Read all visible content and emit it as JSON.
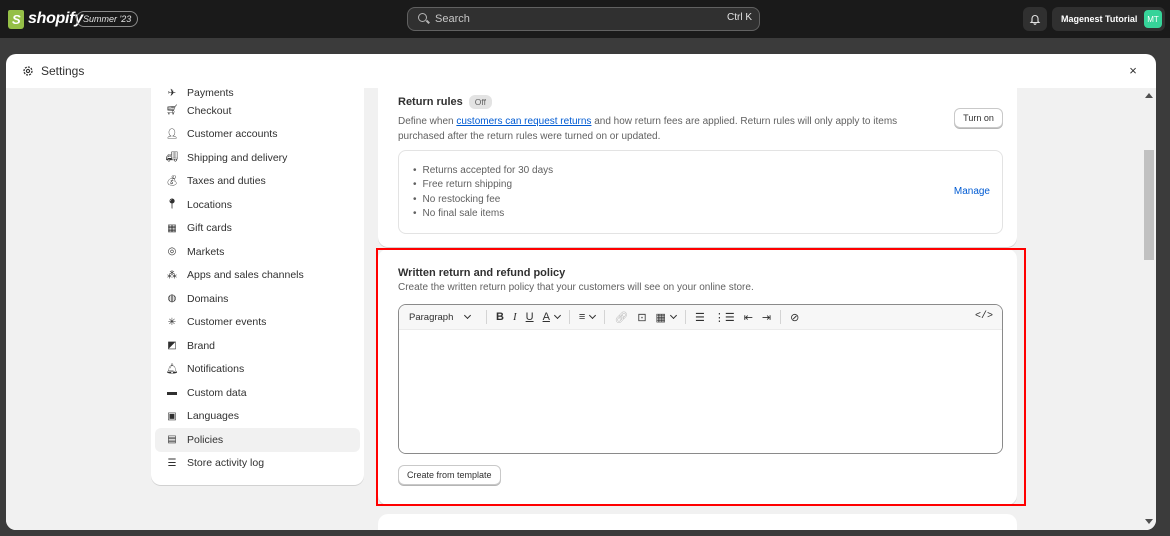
{
  "topbar": {
    "brand": "shopify",
    "edition_badge": "Summer '23",
    "search_placeholder": "Search",
    "search_shortcut": "Ctrl K",
    "user_name": "Magenest Tutorial",
    "user_initials": "MT"
  },
  "modal": {
    "title": "Settings",
    "close_label": "×"
  },
  "sidebar": {
    "items": [
      {
        "label": "Payments",
        "icon": "payments-icon"
      },
      {
        "label": "Checkout",
        "icon": "cart-icon"
      },
      {
        "label": "Customer accounts",
        "icon": "person-icon"
      },
      {
        "label": "Shipping and delivery",
        "icon": "truck-icon"
      },
      {
        "label": "Taxes and duties",
        "icon": "tax-icon"
      },
      {
        "label": "Locations",
        "icon": "location-pin-icon"
      },
      {
        "label": "Gift cards",
        "icon": "gift-card-icon"
      },
      {
        "label": "Markets",
        "icon": "globe-icon"
      },
      {
        "label": "Apps and sales channels",
        "icon": "apps-icon"
      },
      {
        "label": "Domains",
        "icon": "globe-icon"
      },
      {
        "label": "Customer events",
        "icon": "sparkle-icon"
      },
      {
        "label": "Brand",
        "icon": "brand-icon"
      },
      {
        "label": "Notifications",
        "icon": "bell-icon"
      },
      {
        "label": "Custom data",
        "icon": "custom-data-icon"
      },
      {
        "label": "Languages",
        "icon": "language-icon"
      },
      {
        "label": "Policies",
        "icon": "policy-icon",
        "active": true
      },
      {
        "label": "Store activity log",
        "icon": "list-icon"
      }
    ]
  },
  "return_rules": {
    "title": "Return rules",
    "status": "Off",
    "desc_before": "Define when ",
    "desc_link": "customers can request returns",
    "desc_after": " and how return fees are applied. Return rules will only apply to items purchased after the return rules were turned on or updated.",
    "turn_on": "Turn on",
    "rules": [
      "Returns accepted for 30 days",
      "Free return shipping",
      "No restocking fee",
      "No final sale items"
    ],
    "manage": "Manage"
  },
  "written_policy": {
    "title": "Written return and refund policy",
    "desc": "Create the written return policy that your customers will see on your online store.",
    "toolbar": {
      "paragraph": "Paragraph",
      "code": "</>"
    },
    "template_button": "Create from template"
  },
  "colors": {
    "accent_link": "#005bd3",
    "highlight": "#ff0000",
    "avatar_bg": "#36d399",
    "brand_green": "#95bf47"
  }
}
